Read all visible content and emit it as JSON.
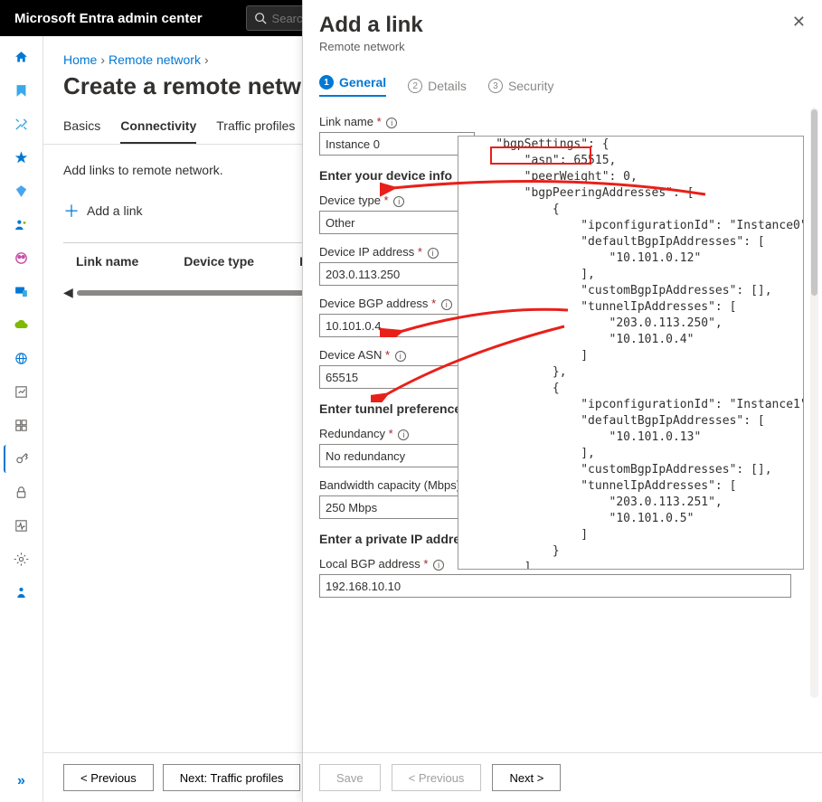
{
  "topbar": {
    "title": "Microsoft Entra admin center",
    "search_placeholder": "Search resources, services, and docs (G+/)"
  },
  "breadcrumbs": {
    "home": "Home",
    "remote": "Remote network"
  },
  "page": {
    "title": "Create a remote network",
    "add_links_text": "Add links to remote network.",
    "add_link_label": "Add a link"
  },
  "tabs": {
    "basics": "Basics",
    "connectivity": "Connectivity",
    "traffic": "Traffic profiles"
  },
  "table": {
    "col1": "Link name",
    "col2": "Device type",
    "col3": "D"
  },
  "bottom": {
    "prev": "< Previous",
    "next": "Next: Traffic profiles"
  },
  "panel": {
    "title": "Add a link",
    "subtitle": "Remote network",
    "tabs": {
      "general": "General",
      "details": "Details",
      "security": "Security",
      "n1": "1",
      "n2": "2",
      "n3": "3"
    },
    "fields": {
      "link_name_lbl": "Link name",
      "link_name": "Instance 0",
      "device_info_hdr": "Enter your device info",
      "device_type_lbl": "Device type",
      "device_type": "Other",
      "device_ip_lbl": "Device IP address",
      "device_ip": "203.0.113.250",
      "device_bgp_lbl": "Device BGP address",
      "device_bgp": "10.101.0.4",
      "device_asn_lbl": "Device ASN",
      "device_asn": "65515",
      "tunnel_hdr": "Enter tunnel preference",
      "redundancy_lbl": "Redundancy",
      "redundancy": "No redundancy",
      "bandwidth_lbl": "Bandwidth capacity (Mbps)",
      "bandwidth": "250 Mbps",
      "private_ip_hdr": "Enter a private IP address you want to use for Microsoft gateway",
      "local_bgp_lbl": "Local BGP address",
      "local_bgp": "192.168.10.10"
    },
    "footer": {
      "save": "Save",
      "prev": "< Previous",
      "next": "Next >"
    }
  },
  "json_box": "    \"bgpSettings\": {\n        \"asn\": 65515,\n        \"peerWeight\": 0,\n        \"bgpPeeringAddresses\": [\n            {\n                \"ipconfigurationId\": \"Instance0\",\n                \"defaultBgpIpAddresses\": [\n                    \"10.101.0.12\"\n                ],\n                \"customBgpIpAddresses\": [],\n                \"tunnelIpAddresses\": [\n                    \"203.0.113.250\",\n                    \"10.101.0.4\"\n                ]\n            },\n            {\n                \"ipconfigurationId\": \"Instance1\",\n                \"defaultBgpIpAddresses\": [\n                    \"10.101.0.13\"\n                ],\n                \"customBgpIpAddresses\": [],\n                \"tunnelIpAddresses\": [\n                    \"203.0.113.251\",\n                    \"10.101.0.5\"\n                ]\n            }\n        ]\n    },"
}
